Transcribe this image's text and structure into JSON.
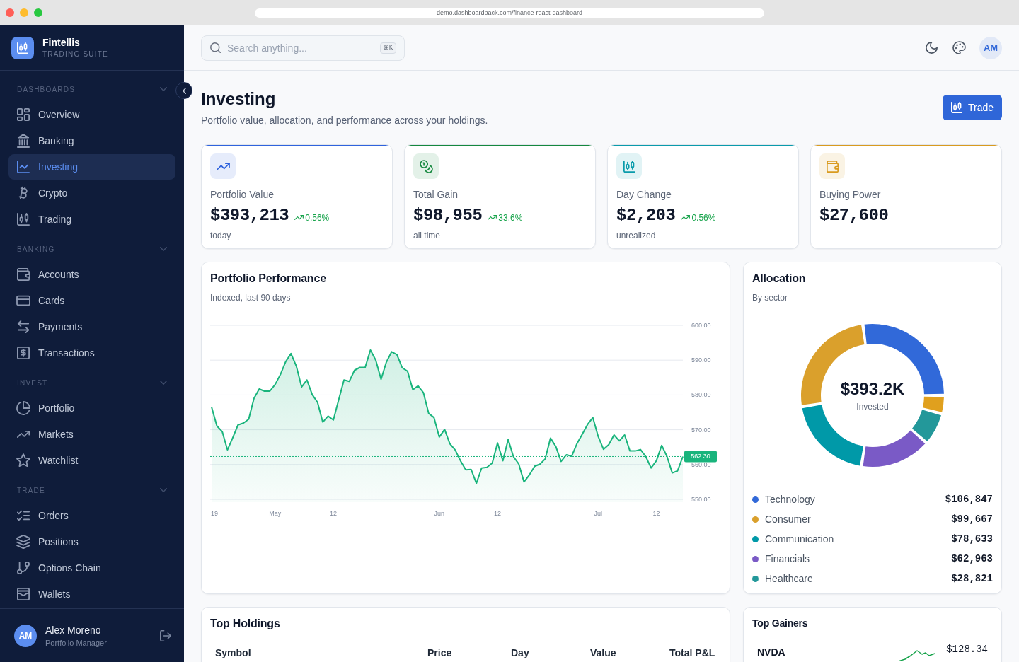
{
  "browser": {
    "url": "demo.dashboardpack.com/finance-react-dashboard"
  },
  "sidebar": {
    "brand": {
      "name": "Fintellis",
      "tagline": "TRADING SUITE"
    },
    "sections": [
      {
        "title": "DASHBOARDS",
        "expanded": true,
        "items": [
          {
            "label": "Overview",
            "selected": false
          },
          {
            "label": "Banking",
            "selected": false
          },
          {
            "label": "Investing",
            "selected": true
          },
          {
            "label": "Crypto",
            "selected": false
          },
          {
            "label": "Trading",
            "selected": false
          }
        ]
      },
      {
        "title": "BANKING",
        "expanded": true,
        "items": [
          {
            "label": "Accounts",
            "selected": false
          },
          {
            "label": "Cards",
            "selected": false
          },
          {
            "label": "Payments",
            "selected": false
          },
          {
            "label": "Transactions",
            "selected": false
          }
        ]
      },
      {
        "title": "INVEST",
        "expanded": true,
        "items": [
          {
            "label": "Portfolio",
            "selected": false
          },
          {
            "label": "Markets",
            "selected": false
          },
          {
            "label": "Watchlist",
            "selected": false
          }
        ]
      },
      {
        "title": "TRADE",
        "expanded": true,
        "items": [
          {
            "label": "Orders",
            "selected": false
          },
          {
            "label": "Positions",
            "selected": false
          },
          {
            "label": "Options Chain",
            "selected": false
          },
          {
            "label": "Wallets",
            "selected": false
          }
        ]
      }
    ],
    "user": {
      "initials": "AM",
      "name": "Alex Moreno",
      "role": "Portfolio Manager"
    }
  },
  "topbar": {
    "search": {
      "placeholder": "Search anything...",
      "shortcut": "⌘K"
    },
    "avatar": "AM"
  },
  "header": {
    "title": "Investing",
    "subtitle": "Portfolio value, allocation, and performance across your holdings.",
    "action": "Trade"
  },
  "kpis": [
    {
      "label": "Portfolio Value",
      "value": "$393,213",
      "change": "0.56%",
      "note": "today",
      "color": "#2f63dd"
    },
    {
      "label": "Total Gain",
      "value": "$98,955",
      "change": "33.6%",
      "note": "all time",
      "color": "#15883e"
    },
    {
      "label": "Day Change",
      "value": "$2,203",
      "change": "0.56%",
      "note": "unrealized",
      "color": "#0a9bab"
    },
    {
      "label": "Buying Power",
      "value": "$27,600",
      "color": "#d99b1f"
    }
  ],
  "performance": {
    "title": "Portfolio Performance",
    "subtitle": "Indexed, last 90 days",
    "chart_data": {
      "type": "area",
      "grid": true,
      "categories": [
        "19",
        null,
        null,
        null,
        null,
        null,
        null,
        null,
        null,
        null,
        null,
        null,
        "May",
        null,
        null,
        null,
        null,
        null,
        null,
        null,
        null,
        null,
        null,
        "12",
        null,
        null,
        null,
        null,
        null,
        null,
        null,
        null,
        null,
        null,
        null,
        null,
        null,
        null,
        null,
        null,
        null,
        null,
        null,
        "Jun",
        null,
        null,
        null,
        null,
        null,
        null,
        null,
        null,
        null,
        null,
        "12",
        null,
        null,
        null,
        null,
        null,
        null,
        null,
        null,
        null,
        null,
        null,
        null,
        null,
        null,
        null,
        null,
        null,
        null,
        "Jul",
        null,
        null,
        null,
        null,
        null,
        null,
        null,
        null,
        null,
        null,
        "12",
        null,
        null,
        null,
        null,
        null
      ],
      "ylim": [
        550,
        600
      ],
      "yticks": [
        {
          "value": 600,
          "label": "600.00"
        },
        {
          "value": 590,
          "label": "590.00"
        },
        {
          "value": 580,
          "label": "580.00"
        },
        {
          "value": 570,
          "label": "570.00"
        },
        {
          "value": 560,
          "label": "560.00"
        },
        {
          "value": 550,
          "label": "550.00"
        }
      ],
      "series": [
        {
          "color": "#19b47c",
          "values": [
            576.5,
            571.1,
            569.5,
            564.2,
            567.7,
            571.4,
            571.9,
            573.0,
            579.0,
            581.7,
            581.1,
            581.1,
            583.0,
            585.9,
            589.6,
            591.9,
            588.3,
            582.3,
            584.3,
            580.1,
            577.9,
            572.2,
            573.9,
            572.8,
            578.6,
            584.3,
            583.9,
            587.1,
            587.9,
            587.9,
            592.9,
            590.0,
            584.5,
            589.4,
            592.4,
            591.6,
            587.8,
            586.8,
            581.5,
            582.6,
            580.7,
            574.7,
            573.5,
            567.9,
            570.1,
            566.0,
            564.2,
            561.1,
            558.5,
            558.6,
            554.6,
            559.0,
            559.2,
            560.4,
            566.2,
            561.1,
            567.2,
            562.3,
            560.2,
            555.0,
            557.0,
            559.5,
            560.1,
            561.6,
            567.6,
            565.2,
            560.9,
            562.8,
            562.4,
            566.0,
            568.7,
            571.5,
            573.5,
            568.1,
            564.4,
            565.7,
            568.5,
            566.8,
            568.5,
            563.9,
            563.9,
            564.3,
            562.3,
            559.0,
            561.1,
            565.5,
            562.3,
            557.6,
            558.2,
            562.3
          ]
        }
      ],
      "ref_lines": [
        {
          "axis": "y",
          "value": 562.3,
          "label": "562.30",
          "color": "#19b47c"
        }
      ]
    }
  },
  "allocation": {
    "title": "Allocation",
    "subtitle": "By sector",
    "total": "$393.2K",
    "total_label": "Invested",
    "chart_data": {
      "type": "donut",
      "values": [
        27.17,
        25.35,
        20.0,
        16.01,
        7.33,
        4.14
      ],
      "colors": [
        "#3169d9",
        "#daa02c",
        "#0099a8",
        "#7a5ac6",
        "#23989a",
        "#e0a01e"
      ]
    },
    "legend": [
      {
        "label": "Technology",
        "value": "$106,847",
        "color": "#3169d9"
      },
      {
        "label": "Consumer",
        "value": "$99,667",
        "color": "#daa02c"
      },
      {
        "label": "Communication",
        "value": "$78,633",
        "color": "#0099a8"
      },
      {
        "label": "Financials",
        "value": "$62,963",
        "color": "#7a5ac6"
      },
      {
        "label": "Healthcare",
        "value": "$28,821",
        "color": "#23989a"
      }
    ]
  },
  "top_holdings": {
    "title": "Top Holdings",
    "columns": [
      "Symbol",
      "Price",
      "Day",
      "Value",
      "Total P&L"
    ]
  },
  "top_gainers": {
    "title": "Top Gainers",
    "items": [
      {
        "symbol": "NVDA",
        "price": "$128.34"
      }
    ]
  }
}
